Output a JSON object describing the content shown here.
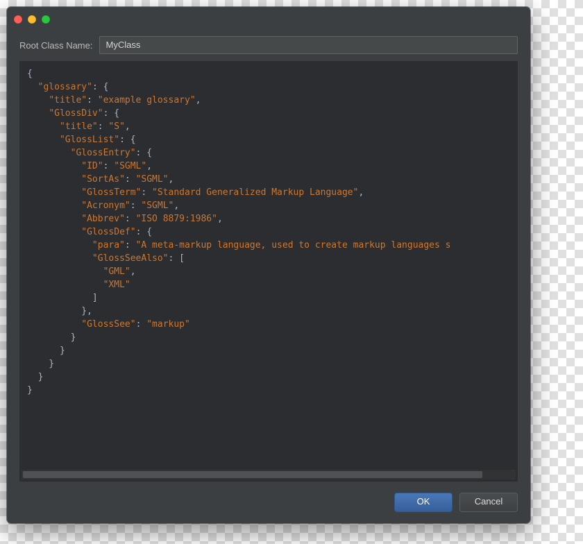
{
  "form": {
    "label": "Root Class Name:",
    "value": "MyClass"
  },
  "buttons": {
    "ok": "OK",
    "cancel": "Cancel"
  },
  "code": {
    "lines": [
      [
        [
          "p",
          "{"
        ]
      ],
      [
        [
          "p",
          "  "
        ],
        [
          "k",
          "\"glossary\""
        ],
        [
          "p",
          ": {"
        ]
      ],
      [
        [
          "p",
          "    "
        ],
        [
          "k",
          "\"title\""
        ],
        [
          "p",
          ": "
        ],
        [
          "s",
          "\"example glossary\""
        ],
        [
          "p",
          ","
        ]
      ],
      [
        [
          "p",
          "    "
        ],
        [
          "k",
          "\"GlossDiv\""
        ],
        [
          "p",
          ": {"
        ]
      ],
      [
        [
          "p",
          "      "
        ],
        [
          "k",
          "\"title\""
        ],
        [
          "p",
          ": "
        ],
        [
          "s",
          "\"S\""
        ],
        [
          "p",
          ","
        ]
      ],
      [
        [
          "p",
          "      "
        ],
        [
          "k",
          "\"GlossList\""
        ],
        [
          "p",
          ": {"
        ]
      ],
      [
        [
          "p",
          "        "
        ],
        [
          "k",
          "\"GlossEntry\""
        ],
        [
          "p",
          ": {"
        ]
      ],
      [
        [
          "p",
          "          "
        ],
        [
          "k",
          "\"ID\""
        ],
        [
          "p",
          ": "
        ],
        [
          "s",
          "\"SGML\""
        ],
        [
          "p",
          ","
        ]
      ],
      [
        [
          "p",
          "          "
        ],
        [
          "k",
          "\"SortAs\""
        ],
        [
          "p",
          ": "
        ],
        [
          "s",
          "\"SGML\""
        ],
        [
          "p",
          ","
        ]
      ],
      [
        [
          "p",
          "          "
        ],
        [
          "k",
          "\"GlossTerm\""
        ],
        [
          "p",
          ": "
        ],
        [
          "s",
          "\"Standard Generalized Markup Language\""
        ],
        [
          "p",
          ","
        ]
      ],
      [
        [
          "p",
          "          "
        ],
        [
          "k",
          "\"Acronym\""
        ],
        [
          "p",
          ": "
        ],
        [
          "s",
          "\"SGML\""
        ],
        [
          "p",
          ","
        ]
      ],
      [
        [
          "p",
          "          "
        ],
        [
          "k",
          "\"Abbrev\""
        ],
        [
          "p",
          ": "
        ],
        [
          "s",
          "\"ISO 8879:1986\""
        ],
        [
          "p",
          ","
        ]
      ],
      [
        [
          "p",
          "          "
        ],
        [
          "k",
          "\"GlossDef\""
        ],
        [
          "p",
          ": {"
        ]
      ],
      [
        [
          "p",
          "            "
        ],
        [
          "k",
          "\"para\""
        ],
        [
          "p",
          ": "
        ],
        [
          "s",
          "\"A meta-markup language, used to create markup languages s"
        ]
      ],
      [
        [
          "p",
          "            "
        ],
        [
          "k",
          "\"GlossSeeAlso\""
        ],
        [
          "p",
          ": ["
        ]
      ],
      [
        [
          "p",
          "              "
        ],
        [
          "s",
          "\"GML\""
        ],
        [
          "p",
          ","
        ]
      ],
      [
        [
          "p",
          "              "
        ],
        [
          "s",
          "\"XML\""
        ]
      ],
      [
        [
          "p",
          "            ]"
        ]
      ],
      [
        [
          "p",
          "          },"
        ]
      ],
      [
        [
          "p",
          "          "
        ],
        [
          "k",
          "\"GlossSee\""
        ],
        [
          "p",
          ": "
        ],
        [
          "s",
          "\"markup\""
        ]
      ],
      [
        [
          "p",
          "        }"
        ]
      ],
      [
        [
          "p",
          "      }"
        ]
      ],
      [
        [
          "p",
          "    }"
        ]
      ],
      [
        [
          "p",
          "  }"
        ]
      ],
      [
        [
          "p",
          "}"
        ]
      ]
    ]
  }
}
